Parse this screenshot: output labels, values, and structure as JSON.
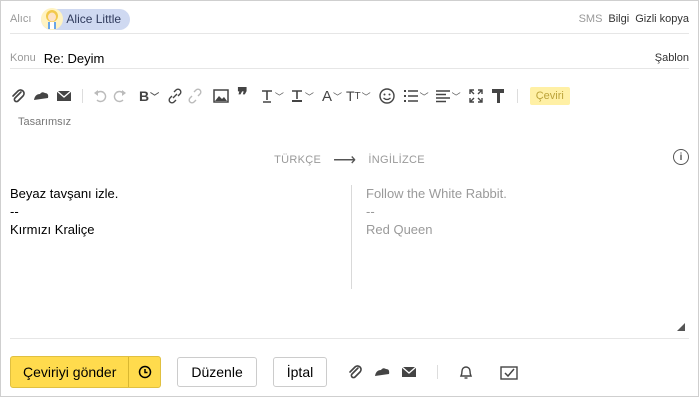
{
  "to": {
    "label": "Alıcı",
    "recipient": "Alice Little",
    "links": {
      "sms": "SMS",
      "info": "Bilgi",
      "bcc": "Gizli kopya"
    }
  },
  "subject": {
    "label": "Konu",
    "value": "Re: Deyim",
    "template": "Şablon"
  },
  "toolbar": {
    "translate": "Çeviri",
    "design_mode": "Tasarımsız"
  },
  "translation": {
    "source_lang": "TÜRKÇE",
    "arrow": "⟶",
    "target_lang": "İNGİLİZCE",
    "info": "i",
    "source_lines": [
      "Beyaz tavşanı izle.",
      "--",
      "Kırmızı Kraliçe"
    ],
    "target_lines": [
      "Follow the White Rabbit.",
      "--",
      "Red Queen"
    ]
  },
  "actions": {
    "send": "Çeviriyi gönder",
    "edit": "Düzenle",
    "cancel": "İptal"
  }
}
